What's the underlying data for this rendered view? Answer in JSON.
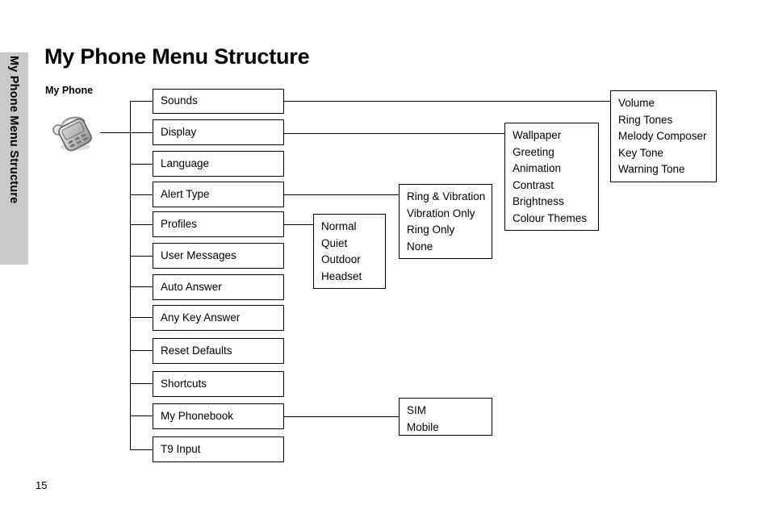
{
  "side_tab": {
    "label": "My Phone Menu Structure"
  },
  "page_title": "My Phone Menu Structure",
  "root": {
    "label": "My Phone",
    "icon": "mobile-phone-icon"
  },
  "page_number": "15",
  "chart_data": {
    "type": "diagram",
    "title": "My Phone Menu Structure",
    "root": "My Phone",
    "level1": [
      {
        "label": "Sounds",
        "children": [
          "Volume",
          "Ring Tones",
          "Melody Composer",
          "Key Tone",
          "Warning Tone"
        ]
      },
      {
        "label": "Display",
        "children": [
          "Wallpaper",
          "Greeting",
          "Animation",
          "Contrast",
          "Brightness",
          "Colour Themes"
        ]
      },
      {
        "label": "Language",
        "children": []
      },
      {
        "label": "Alert Type",
        "children": [
          "Ring & Vibration",
          "Vibration Only",
          "Ring Only",
          "None"
        ]
      },
      {
        "label": "Profiles",
        "children": [
          "Normal",
          "Quiet",
          "Outdoor",
          "Headset"
        ]
      },
      {
        "label": "User Messages",
        "children": []
      },
      {
        "label": "Auto Answer",
        "children": []
      },
      {
        "label": "Any Key Answer",
        "children": []
      },
      {
        "label": "Reset Defaults",
        "children": []
      },
      {
        "label": "Shortcuts",
        "children": []
      },
      {
        "label": "My Phonebook",
        "children": [
          "SIM",
          "Mobile"
        ]
      },
      {
        "label": "T9 Input",
        "children": []
      }
    ]
  },
  "menu": {
    "sounds": "Sounds",
    "display": "Display",
    "language": "Language",
    "alert_type": "Alert Type",
    "profiles": "Profiles",
    "user_messages": "User Messages",
    "auto_answer": "Auto Answer",
    "any_key_answer": "Any Key Answer",
    "reset_defaults": "Reset Defaults",
    "shortcuts": "Shortcuts",
    "my_phonebook": "My Phonebook",
    "t9_input": "T9 Input"
  },
  "sounds_submenu": {
    "items": [
      "Volume",
      "Ring Tones",
      "Melody Composer",
      "Key Tone",
      "Warning Tone"
    ]
  },
  "display_submenu": {
    "items": [
      "Wallpaper",
      "Greeting",
      "Animation",
      "Contrast",
      "Brightness",
      "Colour Themes"
    ]
  },
  "alert_type_submenu": {
    "items": [
      "Ring & Vibration",
      "Vibration Only",
      "Ring Only",
      "None"
    ]
  },
  "profiles_submenu": {
    "items": [
      "Normal",
      "Quiet",
      "Outdoor",
      "Headset"
    ]
  },
  "phonebook_submenu": {
    "items": [
      "SIM",
      "Mobile"
    ]
  },
  "colors": {
    "side_tab_bg": "#c9c9c9",
    "line": "#000000",
    "text": "#000000",
    "page_bg": "#ffffff"
  }
}
